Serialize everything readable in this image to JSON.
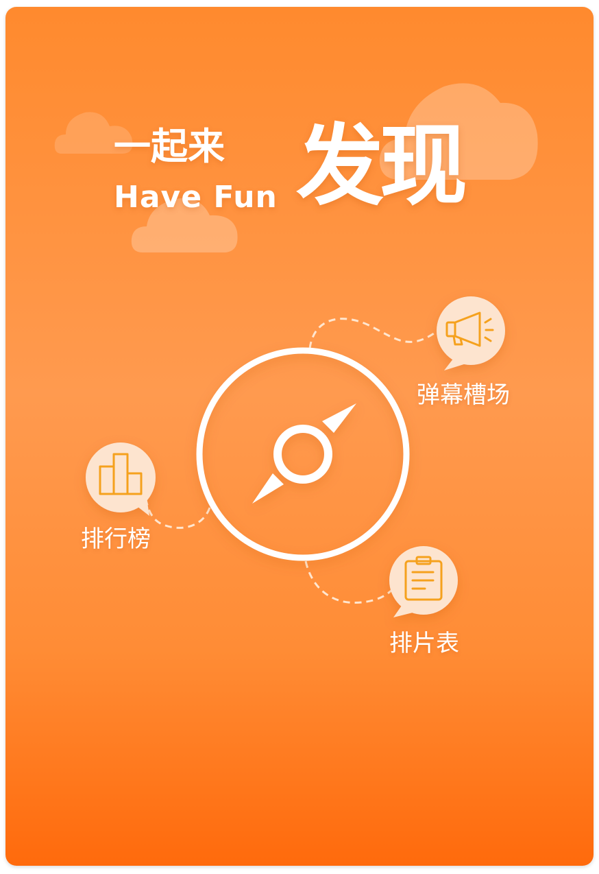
{
  "header": {
    "prefix": "一起来",
    "subtitle": "Have Fun",
    "main": "发现"
  },
  "features": [
    {
      "label": "弹幕槽场",
      "icon": "megaphone-icon"
    },
    {
      "label": "排行榜",
      "icon": "bar-chart-icon"
    },
    {
      "label": "排片表",
      "icon": "clipboard-icon"
    }
  ],
  "center_icon": "compass-icon",
  "colors": {
    "background_top": "#ff8a2e",
    "background_bottom": "#ff6a0c",
    "bubble": "#fde4cf",
    "icon_stroke": "#f5a11d",
    "foreground": "#ffffff"
  }
}
